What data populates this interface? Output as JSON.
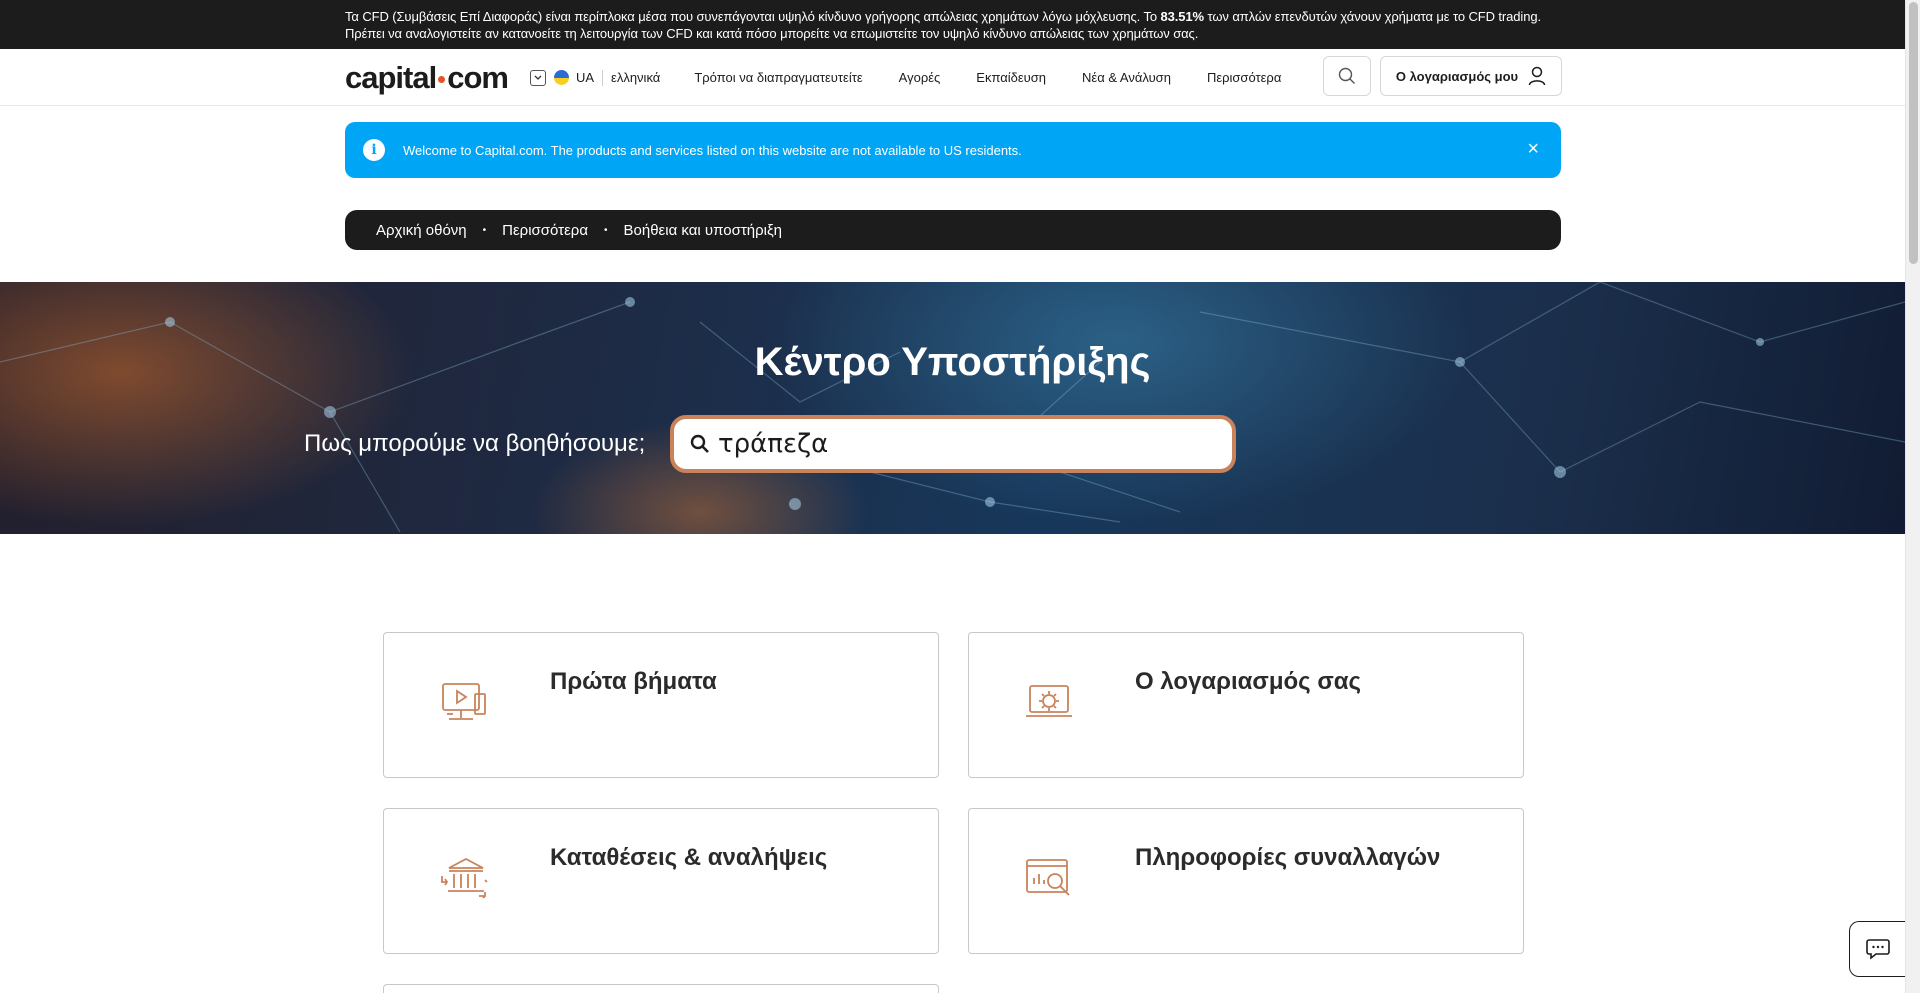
{
  "risk_banner": {
    "part1": "Τα CFD (Συμβάσεις Επί Διαφοράς) είναι περίπλοκα μέσα που συνεπάγονται υψηλό κίνδυνο γρήγορης απώλειας χρημάτων λόγω μόχλευσης. Το ",
    "percent": "83.51%",
    "part2": " των απλών επενδυτών χάνουν χρήματα με το CFD trading. Πρέπει να αναλογιστείτε αν κατανοείτε τη λειτουργία των CFD και κατά πόσο μπορείτε να επωμιστείτε τον υψηλό κίνδυνο απώλειας των χρημάτων σας."
  },
  "header": {
    "logo_left": "capital",
    "logo_right": "com",
    "lang_code": "UA",
    "lang_name": "ελληνικά",
    "nav": [
      "Τρόποι να διαπραγματευτείτε",
      "Αγορές",
      "Εκπαίδευση",
      "Νέα & Ανάλυση",
      "Περισσότερα"
    ],
    "account_label": "Ο λογαριασμός μου"
  },
  "alert": {
    "text": "Welcome to Capital.com. The products and services listed on this website are not available to US residents.",
    "icon": "info-icon",
    "close": "×"
  },
  "breadcrumb": {
    "items": [
      "Αρχική οθόνη",
      "Περισσότερα",
      "Βοήθεια και υποστήριξη"
    ],
    "separator": "•"
  },
  "hero": {
    "title": "Κέντρο Υποστήριξης",
    "prompt": "Πως μπορούμε να βοηθήσουμε;",
    "search_value": "τράπεζα"
  },
  "categories": [
    {
      "title": "Πρώτα βήματα",
      "icon": "video-tutorial-icon"
    },
    {
      "title": "Ο λογαριασμός σας",
      "icon": "account-settings-icon"
    },
    {
      "title": "Καταθέσεις & αναλήψεις",
      "icon": "bank-transfer-icon"
    },
    {
      "title": "Πληροφορίες συναλλαγών",
      "icon": "trading-analytics-icon"
    }
  ],
  "colors": {
    "accent_blue": "#00a6f5",
    "icon_orange": "#c9835b",
    "dark": "#1c1c1c"
  }
}
